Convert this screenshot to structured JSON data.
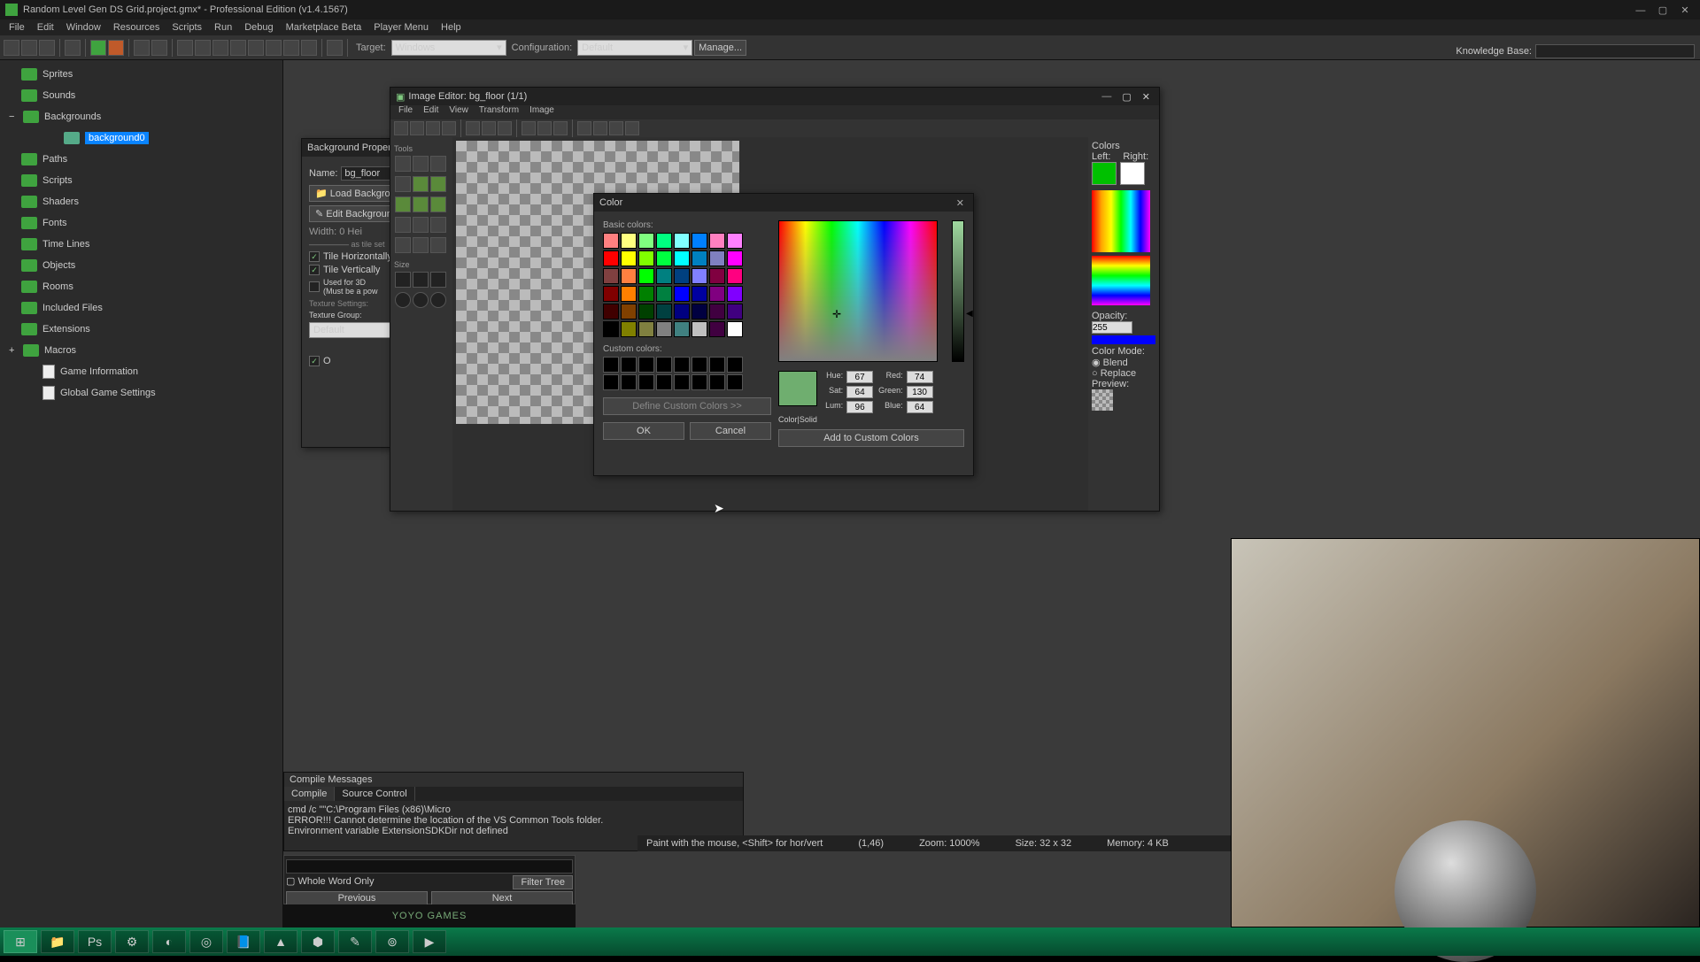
{
  "title": "Random Level Gen DS Grid.project.gmx*  -  Professional Edition (v1.4.1567)",
  "menubar": [
    "File",
    "Edit",
    "Window",
    "Resources",
    "Scripts",
    "Run",
    "Debug",
    "Marketplace Beta",
    "Player Menu",
    "Help"
  ],
  "toolbar": {
    "target_label": "Target:",
    "target_value": "Windows",
    "config_label": "Configuration:",
    "config_value": "Default",
    "manage": "Manage...",
    "kb_label": "Knowledge Base:"
  },
  "tree": {
    "items": [
      {
        "label": "Sprites"
      },
      {
        "label": "Sounds"
      },
      {
        "label": "Backgrounds",
        "expanded": true,
        "children": [
          {
            "label": "background0",
            "selected": true
          }
        ]
      },
      {
        "label": "Paths"
      },
      {
        "label": "Scripts"
      },
      {
        "label": "Shaders"
      },
      {
        "label": "Fonts"
      },
      {
        "label": "Time Lines"
      },
      {
        "label": "Objects"
      },
      {
        "label": "Rooms"
      },
      {
        "label": "Included Files"
      },
      {
        "label": "Extensions"
      },
      {
        "label": "Macros",
        "expander": "+"
      }
    ],
    "extras": [
      {
        "label": "Game Information"
      },
      {
        "label": "Global Game Settings"
      }
    ]
  },
  "bgprops": {
    "title": "Background Properties: backgr",
    "name_label": "Name:",
    "name_value": "bg_floor",
    "load": "Load Background",
    "edit": "Edit Background",
    "width": "Width: 0     Hei",
    "chk1": "Tile Horizontally",
    "chk2": "Tile Vertically",
    "chk3": "Used for 3D\n(Must be a pow",
    "tex": "Texture Settings:",
    "texgroup": "Texture Group:",
    "texval": "Default",
    "ok": "O"
  },
  "imgeditor": {
    "title": "Image Editor: bg_floor (1/1)",
    "menu": [
      "File",
      "Edit",
      "View",
      "Transform",
      "Image"
    ],
    "tools_label": "Tools",
    "size_label": "Size",
    "colors_label": "Colors",
    "left": "Left:",
    "right": "Right:",
    "opacity": "Opacity:",
    "opacity_val": "255",
    "mode": "Color Mode:",
    "blend": "Blend",
    "replace": "Replace",
    "preview": "Preview:",
    "left_color": "#00c000",
    "right_color": "#ffffff"
  },
  "color": {
    "title": "Color",
    "basic": "Basic colors:",
    "custom": "Custom colors:",
    "define": "Define Custom Colors >>",
    "ok": "OK",
    "cancel": "Cancel",
    "add": "Add to Custom Colors",
    "colorsolid": "Color|Solid",
    "hue_l": "Hue:",
    "hue": "67",
    "sat_l": "Sat:",
    "sat": "64",
    "lum_l": "Lum:",
    "lum": "96",
    "red_l": "Red:",
    "red": "74",
    "green_l": "Green:",
    "green": "130",
    "blue_l": "Blue:",
    "blue": "64",
    "preview": "#6fae6f",
    "swatches": [
      "#ff8080",
      "#ffff80",
      "#80ff80",
      "#00ff80",
      "#80ffff",
      "#0080ff",
      "#ff80c0",
      "#ff80ff",
      "#ff0000",
      "#ffff00",
      "#80ff00",
      "#00ff40",
      "#00ffff",
      "#0080c0",
      "#8080c0",
      "#ff00ff",
      "#804040",
      "#ff8040",
      "#00ff00",
      "#008080",
      "#004080",
      "#8080ff",
      "#800040",
      "#ff0080",
      "#800000",
      "#ff8000",
      "#008000",
      "#008040",
      "#0000ff",
      "#0000a0",
      "#800080",
      "#8000ff",
      "#400000",
      "#804000",
      "#004000",
      "#004040",
      "#000080",
      "#000040",
      "#400040",
      "#400080",
      "#000000",
      "#808000",
      "#808040",
      "#808080",
      "#408080",
      "#c0c0c0",
      "#400040",
      "#ffffff"
    ]
  },
  "status": {
    "hint": "Paint with the mouse, <Shift> for hor/vert",
    "pos": "(1,46)",
    "zoom": "Zoom: 1000%",
    "size": "Size: 32 x 32",
    "mem": "Memory: 4 KB"
  },
  "compile": {
    "title": "Compile Messages",
    "tabs": [
      "Compile",
      "Source Control"
    ],
    "lines": [
      "cmd /c \"\"C:\\Program Files (x86)\\Micro",
      "ERROR!!! Cannot determine the location of the VS Common Tools folder.",
      "Environment variable ExtensionSDKDir not defined"
    ]
  },
  "search": {
    "whole": "Whole Word Only",
    "filter": "Filter Tree",
    "prev": "Previous",
    "next": "Next"
  },
  "yoyo": "YOYO GAMES",
  "taskbar_icons": [
    "⊞",
    "📁",
    "Ps",
    "⚙",
    "◐",
    "◎",
    "📘",
    "▲",
    "⬢",
    "✎",
    "⊚",
    "▶"
  ]
}
